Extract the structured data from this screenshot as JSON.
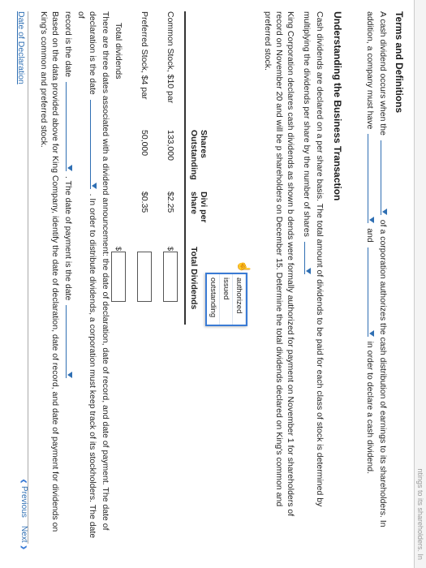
{
  "topbar": {
    "text": "ntings to its shareholders. In"
  },
  "sections": {
    "terms_title": "Terms and Definitions",
    "understanding_title": "Understanding the Business Transaction"
  },
  "terms": {
    "line1_pre": "A cash dividend occurs when the",
    "line1_post": "of a corporation authorizes the cash distribution of earnings to its shareholders. In",
    "line2_pre": "addition, a company must have",
    "line2_mid": "and",
    "line2_post": "in order to declare a cash dividend."
  },
  "understanding": {
    "para1": "Cash dividends are declared on a per share basis. The total amount of dividends to be paid for each class of stock is determined by multiplying the dividends per share by the number of shares",
    "para2_a": "King Corporation declares cash dividends as shown b",
    "para2_b": "dends were formally authorized for payment on November 1 for shareholders of record on November 20 and will be p",
    "para2_c": "shareholders on December 15. Determine the total dividends declared on King's common and preferred stock."
  },
  "popup": {
    "options": [
      "authorized",
      "issued",
      "outstanding"
    ]
  },
  "table": {
    "headers": [
      "",
      "Shares Outstanding",
      "Divi per share",
      "Total Dividends"
    ],
    "rows": [
      {
        "label": "Common Stock, $10 par",
        "shares": "133,000",
        "per_share": "$2.25"
      },
      {
        "label": "Preferred Stock, $4 par",
        "shares": "50,000",
        "per_share": "$0.35"
      },
      {
        "label": "Total dividends",
        "shares": "",
        "per_share": ""
      }
    ],
    "currency": "$"
  },
  "dates": {
    "line1": "There are three dates associated with a dividend announcement: the date of declaration, date of record, and date of payment. The date of",
    "line2_pre": "declaration is the date",
    "line2_post": ". In order to distribute dividends, a corporation must keep track of its stockholders. The date of",
    "line3_pre": "record is the date",
    "line3_mid": ". The date of payment is the date",
    "line4": "Based on the data provided above for King Company, identify the date of declaration, date of record, and date of payment for dividends on King's common and preferred stock."
  },
  "footer": {
    "tab_label": "Date of Declaration",
    "previous_label": "Previous",
    "next_label": "Next"
  },
  "colors": {
    "accent": "#2f6fb3",
    "popup_border": "#3a7bd5"
  }
}
